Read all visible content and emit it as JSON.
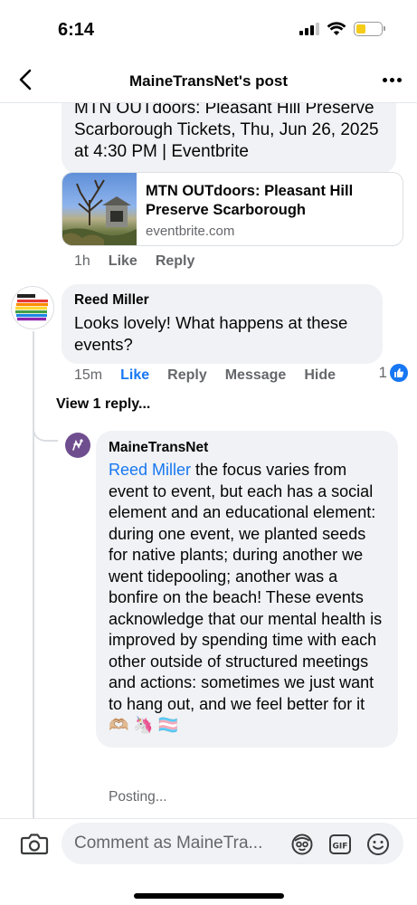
{
  "status_bar": {
    "time": "6:14"
  },
  "nav": {
    "title": "MaineTransNet's post"
  },
  "top_comment": {
    "text": "MTN OUTdoors: Pleasant Hill Preserve Scarborough Tickets, Thu, Jun 26, 2025 at 4:30 PM | Eventbrite",
    "link_title": "MTN OUTdoors: Pleasant Hill Preserve Scarborough",
    "link_domain": "eventbrite.com",
    "time": "1h",
    "like": "Like",
    "reply": "Reply"
  },
  "reed_comment": {
    "author": "Reed Miller",
    "text": "Looks lovely! What happens at these events?",
    "time": "15m",
    "like": "Like",
    "reply": "Reply",
    "message": "Message",
    "hide": "Hide",
    "like_count": "1"
  },
  "view_replies": "View 1 reply...",
  "reply": {
    "author": "MaineTransNet",
    "mention": "Reed Miller",
    "text": " the focus varies from event to event, but each has a social element and an educational element: during one event, we planted seeds for native plants; during another we went tidepooling; another was a bonfire on the beach! These events acknowledge that our mental health is improved by spending time with each other outside of structured meetings and actions: sometimes we just want to hang out, and we feel better for it 🫶🏼 🦄 🏳️‍⚧️",
    "status": "Posting..."
  },
  "composer": {
    "placeholder": "Comment as MaineTra..."
  },
  "colors": {
    "accent": "#1877f2",
    "bubble": "#f0f2f5",
    "muted": "#65676b"
  }
}
